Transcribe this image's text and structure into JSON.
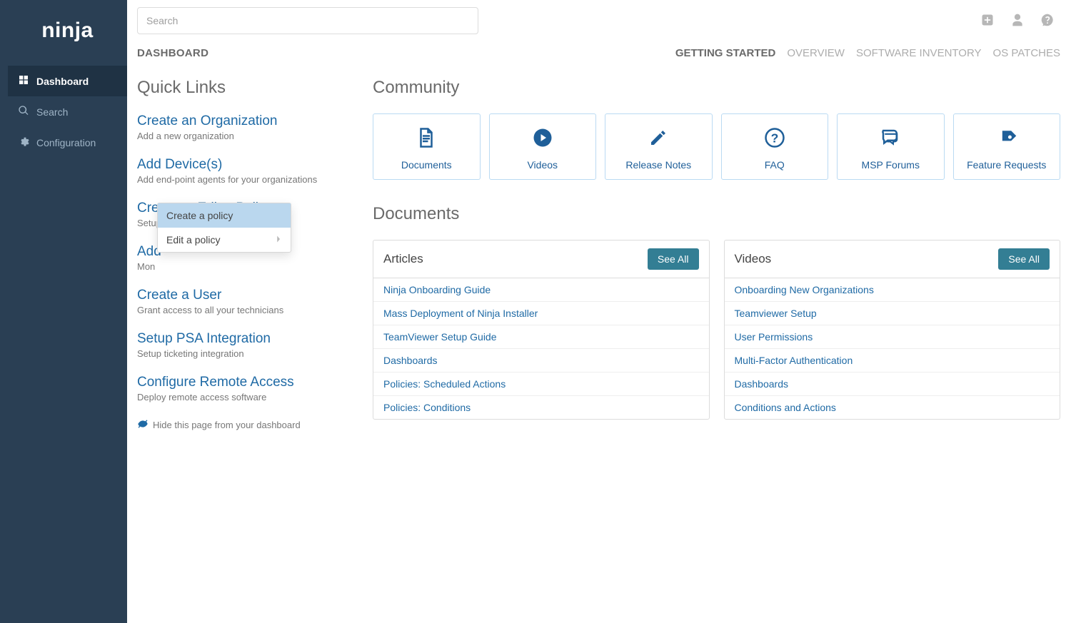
{
  "brand": "ninja",
  "search": {
    "placeholder": "Search"
  },
  "breadcrumb": "DASHBOARD",
  "nav": {
    "items": [
      {
        "label": "Dashboard"
      },
      {
        "label": "Search"
      },
      {
        "label": "Configuration"
      }
    ]
  },
  "tabs": {
    "items": [
      {
        "label": "GETTING STARTED"
      },
      {
        "label": "OVERVIEW"
      },
      {
        "label": "SOFTWARE INVENTORY"
      },
      {
        "label": "OS PATCHES"
      }
    ]
  },
  "quicklinks": {
    "heading": "Quick Links",
    "items": [
      {
        "title": "Create an Organization",
        "desc": "Add a new organization"
      },
      {
        "title": "Add Device(s)",
        "desc": "Add end-point agents for your organizations"
      },
      {
        "title": "Create or Edit a Policy",
        "desc": "Setup"
      },
      {
        "title": "Add",
        "desc": "Mon"
      },
      {
        "title": "Create a User",
        "desc": "Grant access to all your technicians"
      },
      {
        "title": "Setup PSA Integration",
        "desc": "Setup ticketing integration"
      },
      {
        "title": "Configure Remote Access",
        "desc": "Deploy remote access software"
      }
    ],
    "hide_text": "Hide this page from your dashboard"
  },
  "popup": {
    "items": [
      {
        "label": "Create a policy"
      },
      {
        "label": "Edit a policy"
      }
    ]
  },
  "community": {
    "heading": "Community",
    "tiles": [
      {
        "label": "Documents"
      },
      {
        "label": "Videos"
      },
      {
        "label": "Release Notes"
      },
      {
        "label": "FAQ"
      },
      {
        "label": "MSP Forums"
      },
      {
        "label": "Feature Requests"
      }
    ]
  },
  "documents": {
    "heading": "Documents",
    "articles": {
      "title": "Articles",
      "seeall": "See All",
      "rows": [
        "Ninja Onboarding Guide",
        "Mass Deployment of Ninja Installer",
        "TeamViewer Setup Guide",
        "Dashboards",
        "Policies: Scheduled Actions",
        "Policies: Conditions"
      ]
    },
    "videos": {
      "title": "Videos",
      "seeall": "See All",
      "rows": [
        "Onboarding New Organizations",
        "Teamviewer Setup",
        "User Permissions",
        "Multi-Factor Authentication",
        "Dashboards",
        "Conditions and Actions"
      ]
    }
  }
}
